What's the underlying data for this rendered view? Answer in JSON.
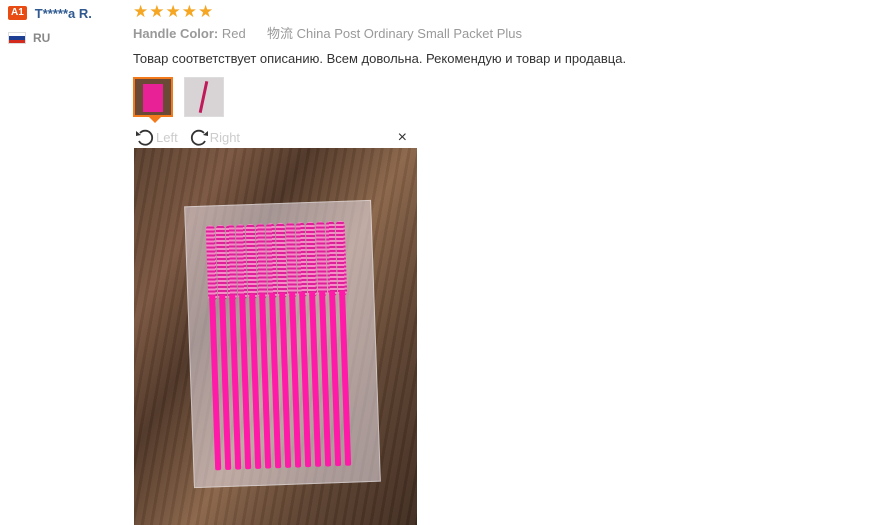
{
  "user": {
    "badge": "A1",
    "name": "T*****a R.",
    "country": "RU",
    "flag_colors": [
      "#ffffff",
      "#1c3f94",
      "#d52b1e"
    ]
  },
  "review": {
    "rating": 5,
    "star_color": "#f5a623",
    "handle_color_label": "Handle Color:",
    "handle_color_value": "Red",
    "logistics_label": "物流",
    "logistics_value": "China Post Ordinary Small Packet Plus",
    "text": "Товар соответствует описанию. Всем довольна. Рекомендую и товар и продавца."
  },
  "thumbnails": [
    {
      "name": "photo-1",
      "active": true
    },
    {
      "name": "photo-2",
      "active": false
    }
  ],
  "viewer": {
    "rotate_left_label": "Left",
    "rotate_right_label": "Right",
    "close_label": "×"
  }
}
